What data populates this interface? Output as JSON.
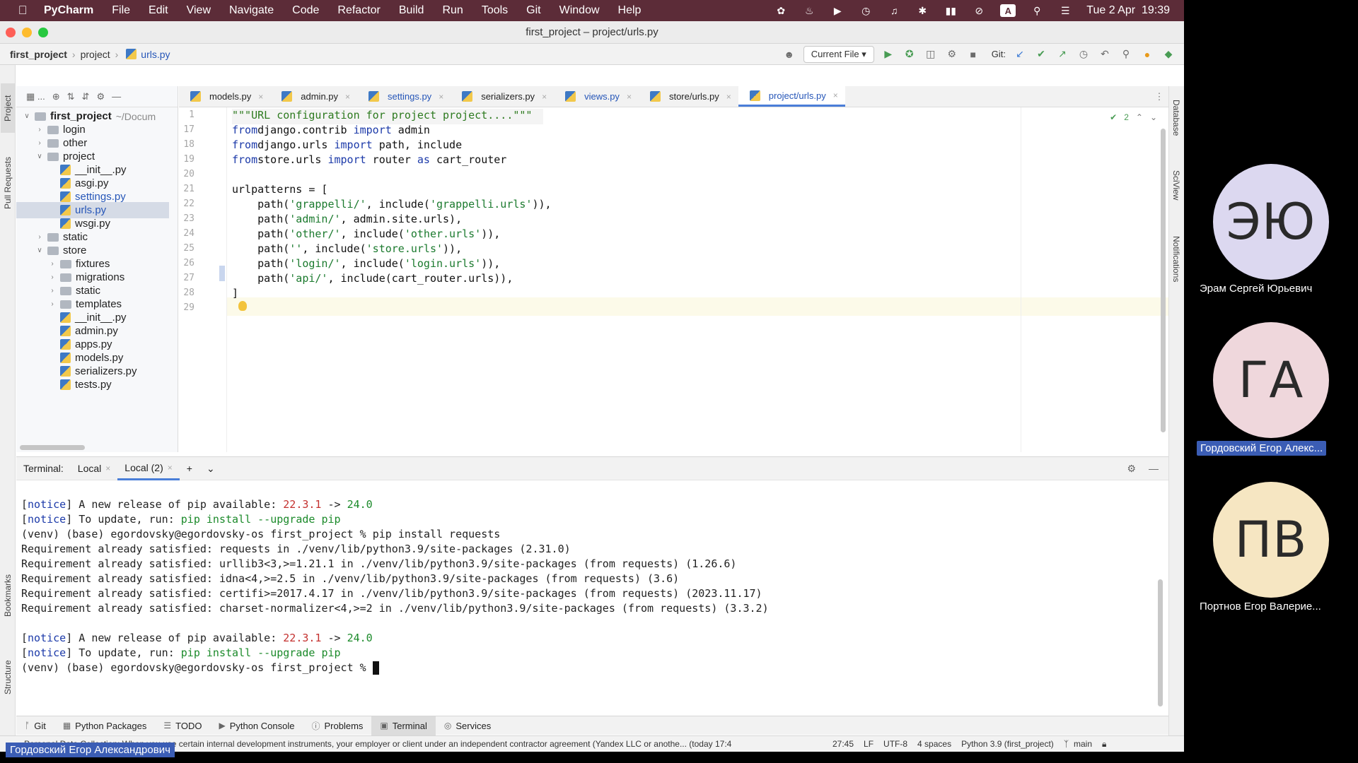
{
  "menubar": {
    "app": "PyCharm",
    "items": [
      "File",
      "Edit",
      "View",
      "Navigate",
      "Code",
      "Refactor",
      "Build",
      "Run",
      "Tools",
      "Git",
      "Window",
      "Help"
    ],
    "input_badge": "A",
    "clock": "Tue 2 Apr  19:39"
  },
  "window": {
    "title": "first_project – project/urls.py"
  },
  "navbar": {
    "crumbs": [
      "first_project",
      "project",
      "urls.py"
    ],
    "run_config": "Current File",
    "git_label": "Git:"
  },
  "side_tabs": {
    "left": [
      "Project",
      "Pull Requests",
      "Bookmarks",
      "Structure"
    ],
    "right": [
      "Database",
      "SciView",
      "Notifications"
    ]
  },
  "project_tree": [
    {
      "label": "first_project",
      "suffix": "~/Docum",
      "type": "folder",
      "depth": 0,
      "open": true,
      "bold": true
    },
    {
      "label": "login",
      "type": "folder",
      "depth": 1,
      "open": false
    },
    {
      "label": "other",
      "type": "folder",
      "depth": 1,
      "open": false
    },
    {
      "label": "project",
      "type": "folder",
      "depth": 1,
      "open": true
    },
    {
      "label": "__init__.py",
      "type": "py",
      "depth": 2
    },
    {
      "label": "asgi.py",
      "type": "py",
      "depth": 2
    },
    {
      "label": "settings.py",
      "type": "py",
      "depth": 2,
      "blue": true
    },
    {
      "label": "urls.py",
      "type": "py",
      "depth": 2,
      "blue": true,
      "selected": true
    },
    {
      "label": "wsgi.py",
      "type": "py",
      "depth": 2
    },
    {
      "label": "static",
      "type": "folder",
      "depth": 1,
      "open": false
    },
    {
      "label": "store",
      "type": "folder",
      "depth": 1,
      "open": true
    },
    {
      "label": "fixtures",
      "type": "folder",
      "depth": 2,
      "open": false
    },
    {
      "label": "migrations",
      "type": "folder",
      "depth": 2,
      "open": false
    },
    {
      "label": "static",
      "type": "folder",
      "depth": 2,
      "open": false
    },
    {
      "label": "templates",
      "type": "folder",
      "depth": 2,
      "open": false
    },
    {
      "label": "__init__.py",
      "type": "py",
      "depth": 2
    },
    {
      "label": "admin.py",
      "type": "py",
      "depth": 2
    },
    {
      "label": "apps.py",
      "type": "py",
      "depth": 2
    },
    {
      "label": "models.py",
      "type": "py",
      "depth": 2
    },
    {
      "label": "serializers.py",
      "type": "py",
      "depth": 2
    },
    {
      "label": "tests.py",
      "type": "py",
      "depth": 2
    }
  ],
  "editor_tabs": [
    {
      "label": "models.py",
      "active": false,
      "blue": false
    },
    {
      "label": "admin.py",
      "active": false,
      "blue": false
    },
    {
      "label": "settings.py",
      "active": false,
      "blue": true
    },
    {
      "label": "serializers.py",
      "active": false,
      "blue": false
    },
    {
      "label": "views.py",
      "active": false,
      "blue": true
    },
    {
      "label": "store/urls.py",
      "active": false,
      "blue": false
    },
    {
      "label": "project/urls.py",
      "active": true,
      "blue": true
    }
  ],
  "editor": {
    "inspection_count": "2",
    "lines": [
      {
        "n": "1",
        "tokens": [
          [
            "doc",
            "\"\"\"URL configuration for project project....\"\"\""
          ]
        ]
      },
      {
        "n": "17",
        "tokens": [
          [
            "kw",
            "from"
          ],
          [
            "",
            "django.contrib "
          ],
          [
            "kw",
            "import"
          ],
          [
            "",
            " admin"
          ]
        ]
      },
      {
        "n": "18",
        "tokens": [
          [
            "kw",
            "from"
          ],
          [
            "",
            "django.urls "
          ],
          [
            "kw",
            "import"
          ],
          [
            "",
            " path, include"
          ]
        ]
      },
      {
        "n": "19",
        "tokens": [
          [
            "kw",
            "from"
          ],
          [
            "",
            "store.urls "
          ],
          [
            "kw",
            "import"
          ],
          [
            "",
            " router "
          ],
          [
            "kw",
            "as"
          ],
          [
            "",
            " cart_router"
          ]
        ]
      },
      {
        "n": "20",
        "tokens": []
      },
      {
        "n": "21",
        "tokens": [
          [
            "",
            "urlpatterns = ["
          ]
        ]
      },
      {
        "n": "22",
        "tokens": [
          [
            "",
            "    path("
          ],
          [
            "str",
            "'grappelli/'"
          ],
          [
            "",
            ", include("
          ],
          [
            "str",
            "'grappelli.urls'"
          ],
          [
            "",
            ")),"
          ]
        ]
      },
      {
        "n": "23",
        "tokens": [
          [
            "",
            "    path("
          ],
          [
            "str",
            "'admin/'"
          ],
          [
            "",
            ", admin.site.urls),"
          ]
        ]
      },
      {
        "n": "24",
        "tokens": [
          [
            "",
            "    path("
          ],
          [
            "str",
            "'other/'"
          ],
          [
            "",
            ", include("
          ],
          [
            "str",
            "'other.urls'"
          ],
          [
            "",
            ")),"
          ]
        ]
      },
      {
        "n": "25",
        "tokens": [
          [
            "",
            "    path("
          ],
          [
            "str",
            "''"
          ],
          [
            "",
            ", include("
          ],
          [
            "str",
            "'store.urls'"
          ],
          [
            "",
            ")),"
          ]
        ]
      },
      {
        "n": "26",
        "tokens": [
          [
            "",
            "    path("
          ],
          [
            "str",
            "'login/'"
          ],
          [
            "",
            ", include("
          ],
          [
            "str",
            "'login.urls'"
          ],
          [
            "",
            ")),"
          ]
        ]
      },
      {
        "n": "27",
        "tokens": [
          [
            "",
            "    path("
          ],
          [
            "str",
            "'api/'"
          ],
          [
            "",
            ", include(cart_router.urls)),"
          ]
        ]
      },
      {
        "n": "28",
        "tokens": [
          [
            "",
            "]"
          ]
        ]
      },
      {
        "n": "29",
        "tokens": []
      }
    ]
  },
  "terminal": {
    "label": "Terminal:",
    "tabs": [
      {
        "label": "Local",
        "active": false
      },
      {
        "label": "Local (2)",
        "active": true
      }
    ],
    "lines": [
      [],
      [
        [
          "",
          "["
        ],
        [
          "nb",
          "notice"
        ],
        [
          "",
          "] A new release of pip available: "
        ],
        [
          "red",
          "22.3.1"
        ],
        [
          "",
          " -> "
        ],
        [
          "grn",
          "24.0"
        ]
      ],
      [
        [
          "",
          "["
        ],
        [
          "nb",
          "notice"
        ],
        [
          "",
          "] To update, run: "
        ],
        [
          "grn",
          "pip install --upgrade pip"
        ]
      ],
      [
        [
          "",
          "(venv) (base) egordovsky@egordovsky-os first_project % pip install requests"
        ]
      ],
      [
        [
          "",
          "Requirement already satisfied: requests in ./venv/lib/python3.9/site-packages (2.31.0)"
        ]
      ],
      [
        [
          "",
          "Requirement already satisfied: urllib3<3,>=1.21.1 in ./venv/lib/python3.9/site-packages (from requests) (1.26.6)"
        ]
      ],
      [
        [
          "",
          "Requirement already satisfied: idna<4,>=2.5 in ./venv/lib/python3.9/site-packages (from requests) (3.6)"
        ]
      ],
      [
        [
          "",
          "Requirement already satisfied: certifi>=2017.4.17 in ./venv/lib/python3.9/site-packages (from requests) (2023.11.17)"
        ]
      ],
      [
        [
          "",
          "Requirement already satisfied: charset-normalizer<4,>=2 in ./venv/lib/python3.9/site-packages (from requests) (3.3.2)"
        ]
      ],
      [],
      [
        [
          "",
          "["
        ],
        [
          "nb",
          "notice"
        ],
        [
          "",
          "] A new release of pip available: "
        ],
        [
          "red",
          "22.3.1"
        ],
        [
          "",
          " -> "
        ],
        [
          "grn",
          "24.0"
        ]
      ],
      [
        [
          "",
          "["
        ],
        [
          "nb",
          "notice"
        ],
        [
          "",
          "] To update, run: "
        ],
        [
          "grn",
          "pip install --upgrade pip"
        ]
      ],
      [
        [
          "",
          "(venv) (base) egordovsky@egordovsky-os first_project % "
        ]
      ]
    ]
  },
  "tool_windows": [
    {
      "label": "Git",
      "active": false
    },
    {
      "label": "Python Packages",
      "active": false
    },
    {
      "label": "TODO",
      "active": false
    },
    {
      "label": "Python Console",
      "active": false
    },
    {
      "label": "Problems",
      "active": false
    },
    {
      "label": "Terminal",
      "active": true
    },
    {
      "label": "Services",
      "active": false
    }
  ],
  "statusbar": {
    "message": "Personal Data Collection: When you use certain internal development instruments, your employer or client under an independent contractor agreement (Yandex LLC or anothe... (today 17:4",
    "position": "27:45",
    "line_sep": "LF",
    "encoding": "UTF-8",
    "indent": "4 spaces",
    "interpreter": "Python 3.9 (first_project)",
    "branch": "main"
  },
  "participants": [
    {
      "initials": "ЭЮ",
      "name": "Эрам Сергей Юрьевич",
      "color": "#dcd8f0",
      "highlight": false
    },
    {
      "initials": "ГА",
      "name": "Гордовский Егор Алекс...",
      "color": "#efd7dc",
      "highlight": true
    },
    {
      "initials": "ПВ",
      "name": "Портнов Егор Валерие...",
      "color": "#f6e6c2",
      "highlight": false
    }
  ],
  "active_speaker": "Гордовский Егор Александрович"
}
